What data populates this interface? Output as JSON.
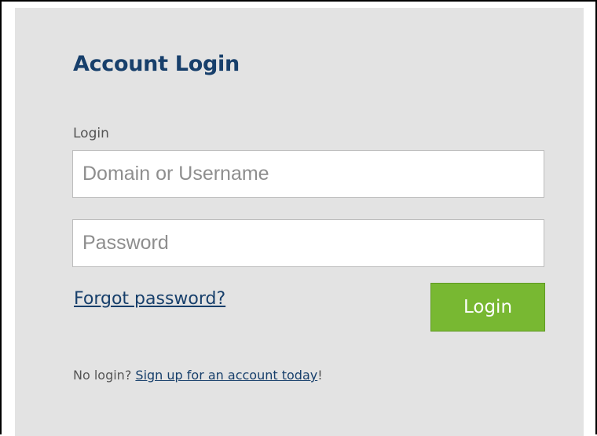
{
  "form": {
    "title": "Account Login",
    "field_label": "Login",
    "username": {
      "placeholder": "Domain or Username",
      "value": ""
    },
    "password": {
      "placeholder": "Password",
      "value": ""
    },
    "forgot_link": "Forgot password?",
    "submit_label": "Login",
    "signup_prefix": "No login? ",
    "signup_link": "Sign up for an account today",
    "signup_suffix": "!"
  },
  "colors": {
    "title": "#173f6b",
    "panel_background": "#e3e3e3",
    "button_background": "#78b832",
    "link": "#173f6b"
  }
}
